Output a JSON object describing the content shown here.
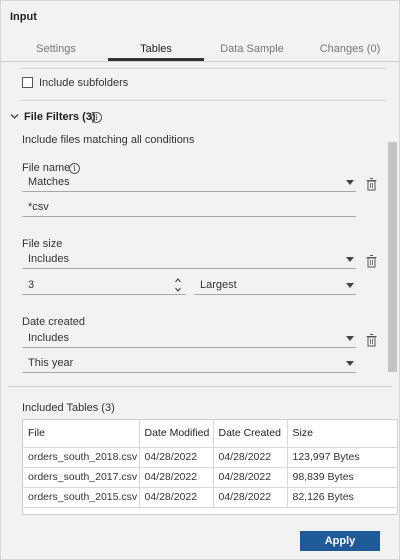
{
  "panel": {
    "title": "Input"
  },
  "tabs": [
    {
      "label": "Settings"
    },
    {
      "label": "Tables",
      "active": true
    },
    {
      "label": "Data Sample"
    },
    {
      "label": "Changes (0)"
    }
  ],
  "include_subfolders": {
    "label": "Include subfolders",
    "checked": false
  },
  "file_filters": {
    "title": "File Filters (3)",
    "description": "Include files matching all conditions",
    "file_name": {
      "label": "File name",
      "operator": "Matches",
      "value": "*csv"
    },
    "file_size": {
      "label": "File size",
      "operator": "Includes",
      "count": "3",
      "order": "Largest"
    },
    "date_created": {
      "label": "Date created",
      "operator": "Includes",
      "period": "This year"
    }
  },
  "included_tables": {
    "title": "Included Tables (3)",
    "columns": [
      "File",
      "Date Modified",
      "Date Created",
      "Size"
    ],
    "rows": [
      [
        "orders_south_2018.csv",
        "04/28/2022",
        "04/28/2022",
        "123,997 Bytes"
      ],
      [
        "orders_south_2017.csv",
        "04/28/2022",
        "04/28/2022",
        "98,839 Bytes"
      ],
      [
        "orders_south_2015.csv",
        "04/28/2022",
        "04/28/2022",
        "82,126 Bytes"
      ]
    ]
  },
  "footer": {
    "apply_label": "Apply"
  },
  "colors": {
    "primary_button": "#1f5b98",
    "background": "#f2f2f2"
  }
}
